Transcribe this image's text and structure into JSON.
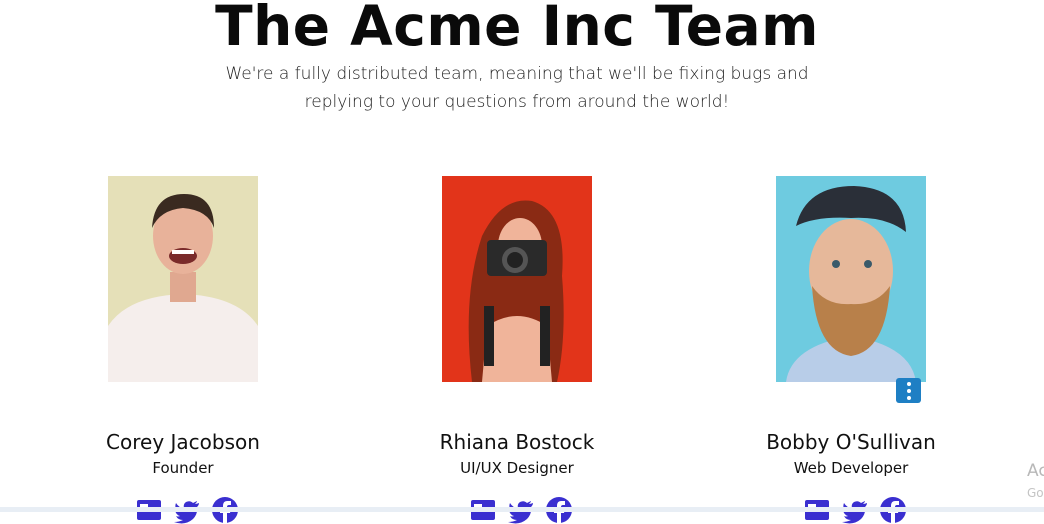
{
  "header": {
    "title": "The Acme Inc Team",
    "subtitle": "We're a fully distributed team, meaning that we'll be fixing bugs and replying to your questions from around the world!"
  },
  "team": [
    {
      "name": "Corey Jacobson",
      "role": "Founder"
    },
    {
      "name": "Rhiana Bostock",
      "role": "UI/UX Designer"
    },
    {
      "name": "Bobby O'Sullivan",
      "role": "Web Developer"
    }
  ],
  "social_icons": [
    "card-icon",
    "twitter-icon",
    "facebook-icon"
  ],
  "overlay": {
    "line1": "Ac",
    "line2": "Go"
  },
  "colors": {
    "social": "#3a2fd0",
    "more_button": "#1e7fc4"
  }
}
